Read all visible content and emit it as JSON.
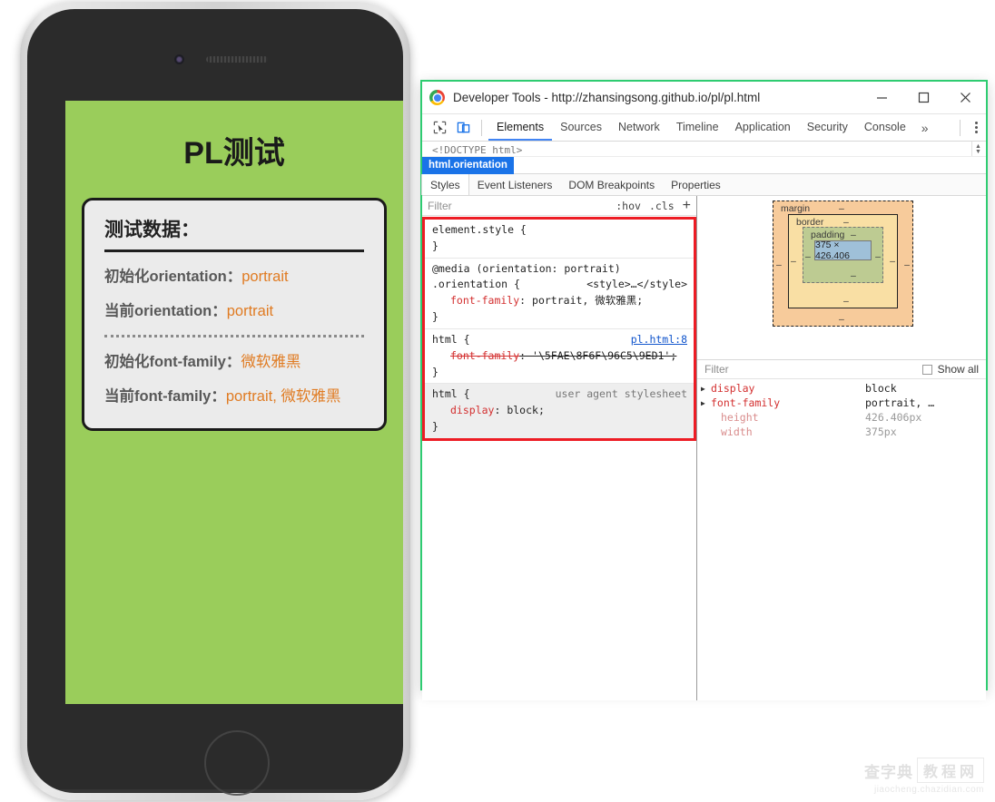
{
  "phone": {
    "screen": {
      "title": "PL测试",
      "card_heading": "测试数据：",
      "rows": [
        {
          "label": "初始化orientation：",
          "value": "portrait"
        },
        {
          "label": "当前orientation：",
          "value": "portrait"
        },
        {
          "label": "初始化font-family：",
          "value": "微软雅黑"
        },
        {
          "label": "当前font-family：",
          "value": "portrait, 微软雅黑"
        }
      ]
    },
    "colors": {
      "screen_bg": "#9ACD5B",
      "card_bg": "#EBEBEB",
      "value_orange": "#E07B22",
      "label_gray": "#585858"
    }
  },
  "devtools": {
    "titlebar": {
      "logo_icon": "chrome-logo-icon",
      "title": "Developer Tools - http://zhansingsong.github.io/pl/pl.html",
      "minimize_label": "—",
      "maximize_label": "▢",
      "close_label": "✕"
    },
    "toolbar": {
      "inspect_icon": "inspect-element-icon",
      "device_icon": "device-toolbar-icon",
      "tabs": [
        "Elements",
        "Sources",
        "Network",
        "Timeline",
        "Application",
        "Security",
        "Console"
      ],
      "active_tab": "Elements",
      "more_label": "»",
      "kebab_icon": "more-options-icon"
    },
    "dom": {
      "doctype_line": "<!DOCTYPE html>",
      "scroll_icon": "vertical-scroll-stepper-icon"
    },
    "breadcrumb": {
      "item": "html.orientation"
    },
    "sidebar_tabs": {
      "items": [
        "Styles",
        "Event Listeners",
        "DOM Breakpoints",
        "Properties"
      ],
      "active": "Styles"
    },
    "styles_filter": {
      "placeholder": "Filter",
      "hov_label": ":hov",
      "cls_label": ".cls",
      "new_rule_label": "+"
    },
    "css_rules": [
      {
        "selector": "element.style {",
        "source": "",
        "source_is_link": false,
        "declarations": [],
        "closing": "}",
        "ua": false
      },
      {
        "media": "@media (orientation: portrait)",
        "selector": ".orientation {",
        "source": "<style>…</style>",
        "source_is_link": false,
        "declarations": [
          {
            "prop": "font-family",
            "value": "portrait, 微软雅黑;",
            "struck": false
          }
        ],
        "closing": "}",
        "ua": false
      },
      {
        "selector": "html {",
        "source": "pl.html:8",
        "source_is_link": true,
        "declarations": [
          {
            "prop": "font-family",
            "value": "'\\5FAE\\8F6F\\96C5\\9ED1';",
            "struck": true
          }
        ],
        "closing": "}",
        "ua": false
      },
      {
        "selector": "html {",
        "source": "user agent stylesheet",
        "source_is_link": false,
        "declarations": [
          {
            "prop": "display",
            "value": "block;",
            "struck": false
          }
        ],
        "closing": "}",
        "ua": true
      }
    ],
    "box_model": {
      "margin_label": "margin",
      "border_label": "border",
      "padding_label": "padding",
      "content_label": "375 × 426.406",
      "dash": "–"
    },
    "computed": {
      "filter_placeholder": "Filter",
      "show_all_label": "Show all",
      "properties": [
        {
          "name": "display",
          "value": "block",
          "expandable": true,
          "inherited": false
        },
        {
          "name": "font-family",
          "value": "portrait, …",
          "expandable": true,
          "inherited": false
        },
        {
          "name": "height",
          "value": "426.406px",
          "expandable": false,
          "inherited": true
        },
        {
          "name": "width",
          "value": "375px",
          "expandable": false,
          "inherited": true
        }
      ]
    }
  },
  "watermark": {
    "brand_left": "查字典",
    "brand_right": "教程网",
    "url": "jiaocheng.chazidian.com"
  }
}
